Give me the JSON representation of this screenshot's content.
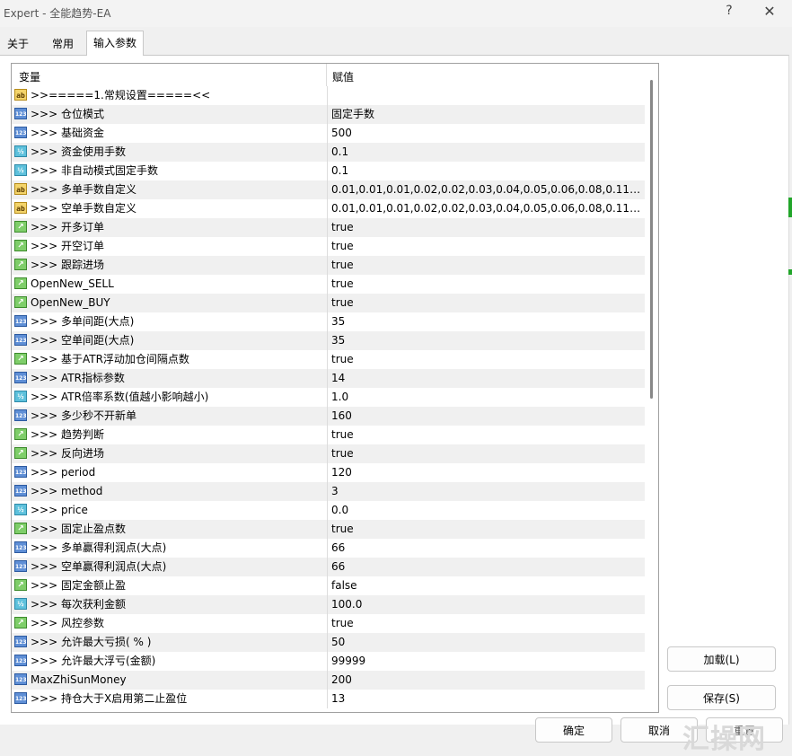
{
  "window": {
    "title": "Expert - 全能趋势-EA",
    "help": "?",
    "close": "✕"
  },
  "tabs": [
    "关于",
    "常用",
    "输入参数"
  ],
  "grid": {
    "headers": [
      "变量",
      "赋值"
    ],
    "rows": [
      {
        "type": "str",
        "name": ">>=====1.常规设置=====<<",
        "value": ""
      },
      {
        "type": "int",
        "name": ">>>  仓位模式",
        "value": "固定手数"
      },
      {
        "type": "int",
        "name": ">>>  基础资金",
        "value": "500"
      },
      {
        "type": "dbl",
        "name": ">>>  资金使用手数",
        "value": "0.1"
      },
      {
        "type": "dbl",
        "name": ">>>  非自动模式固定手数",
        "value": "0.1"
      },
      {
        "type": "str",
        "name": ">>>  多单手数自定义",
        "value": "0.01,0.01,0.01,0.02,0.02,0.03,0.04,0.05,0.06,0.08,0.11,0.14,0...."
      },
      {
        "type": "str",
        "name": ">>>  空单手数自定义",
        "value": "0.01,0.01,0.01,0.02,0.02,0.03,0.04,0.05,0.06,0.08,0.11,0.14,0...."
      },
      {
        "type": "bool",
        "name": ">>>  开多订单",
        "value": "true"
      },
      {
        "type": "bool",
        "name": ">>>  开空订单",
        "value": "true"
      },
      {
        "type": "bool",
        "name": ">>>  跟踪进场",
        "value": "true"
      },
      {
        "type": "bool",
        "name": "OpenNew_SELL",
        "value": "true"
      },
      {
        "type": "bool",
        "name": "OpenNew_BUY",
        "value": "true"
      },
      {
        "type": "int",
        "name": ">>>  多单间距(大点)",
        "value": "35"
      },
      {
        "type": "int",
        "name": ">>>  空单间距(大点)",
        "value": "35"
      },
      {
        "type": "bool",
        "name": ">>>  基于ATR浮动加仓间隔点数",
        "value": "true"
      },
      {
        "type": "int",
        "name": ">>>  ATR指标参数",
        "value": "14"
      },
      {
        "type": "dbl",
        "name": ">>>  ATR倍率系数(值越小影响越小)",
        "value": "1.0"
      },
      {
        "type": "int",
        "name": ">>>  多少秒不开新单",
        "value": "160"
      },
      {
        "type": "bool",
        "name": ">>>  趋势判断",
        "value": "true"
      },
      {
        "type": "bool",
        "name": ">>>  反向进场",
        "value": "true"
      },
      {
        "type": "int",
        "name": ">>>  period",
        "value": "120"
      },
      {
        "type": "int",
        "name": ">>>  method",
        "value": "3"
      },
      {
        "type": "dbl",
        "name": ">>>  price",
        "value": "0.0"
      },
      {
        "type": "bool",
        "name": ">>>  固定止盈点数",
        "value": "true"
      },
      {
        "type": "int",
        "name": ">>>  多单赢得利润点(大点)",
        "value": "66"
      },
      {
        "type": "int",
        "name": ">>>  空单赢得利润点(大点)",
        "value": "66"
      },
      {
        "type": "bool",
        "name": ">>>  固定金额止盈",
        "value": "false"
      },
      {
        "type": "dbl",
        "name": ">>>  每次获利金额",
        "value": "100.0"
      },
      {
        "type": "bool",
        "name": ">>>  风控参数",
        "value": "true"
      },
      {
        "type": "int",
        "name": ">>>  允许最大亏损( % )",
        "value": "50"
      },
      {
        "type": "int",
        "name": ">>>  允许最大浮亏(金额)",
        "value": "99999"
      },
      {
        "type": "int",
        "name": "MaxZhiSunMoney",
        "value": "200"
      },
      {
        "type": "int",
        "name": ">>>  持仓大于X启用第二止盈位",
        "value": "13"
      }
    ]
  },
  "icons": {
    "str": "ab",
    "int": "123",
    "dbl": "1/2",
    "bool": "bool-chart-icon"
  },
  "buttons": {
    "load": "加载(L)",
    "save": "保存(S)",
    "ok": "确定",
    "cancel": "取消",
    "reset": "重置"
  },
  "watermark": "汇操网"
}
